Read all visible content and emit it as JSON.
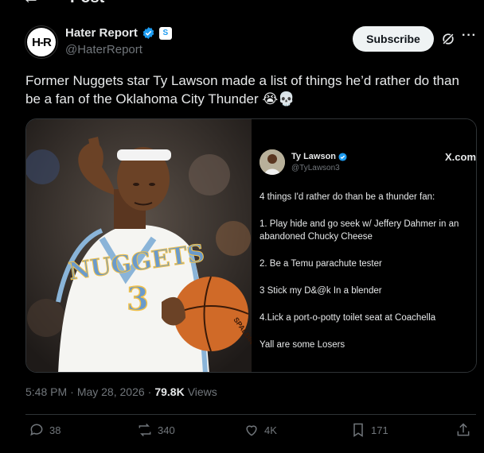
{
  "header": {
    "title": "Post",
    "back_icon": "arrow-left-icon"
  },
  "author": {
    "avatar_text": "H-R",
    "display_name": "Hater Report",
    "handle": "@HaterReport",
    "verified": true,
    "affiliate_badge": "S"
  },
  "actions_top": {
    "subscribe_label": "Subscribe",
    "grok_icon": "grok-icon",
    "more_icon": "more-icon"
  },
  "tweet": {
    "text": "Former Nuggets star Ty Lawson made a list of things he’d rather do than be a fan of the Oklahoma City Thunder 😭💀"
  },
  "media": {
    "jersey_text": "NUGGETS",
    "jersey_number": "3",
    "ball_text": "SPALDING",
    "embedded_tweet": {
      "name": "Ty Lawson",
      "handle": "@TyLawson3",
      "watermark": "X.com",
      "lines": [
        "4 things I'd rather do than be a thunder fan:",
        "1. Play hide and go seek w/ Jeffery Dahmer in an abandoned Chucky Cheese",
        "2. Be a Temu parachute tester",
        "3 Stick my D&@k In a blender",
        "4.Lick a port-o-potty toilet seat at Coachella",
        "Yall are some Losers"
      ]
    }
  },
  "meta": {
    "time": "5:48 PM",
    "sep1": "·",
    "date": "May 28, 2026",
    "sep2": "·",
    "views_count": "79.8K",
    "views_label": "Views"
  },
  "engagement": {
    "replies": "38",
    "reposts": "340",
    "likes": "4K",
    "bookmarks": "171"
  },
  "colors": {
    "accent": "#1d9bf0",
    "background": "#000000",
    "muted": "#71767b"
  }
}
